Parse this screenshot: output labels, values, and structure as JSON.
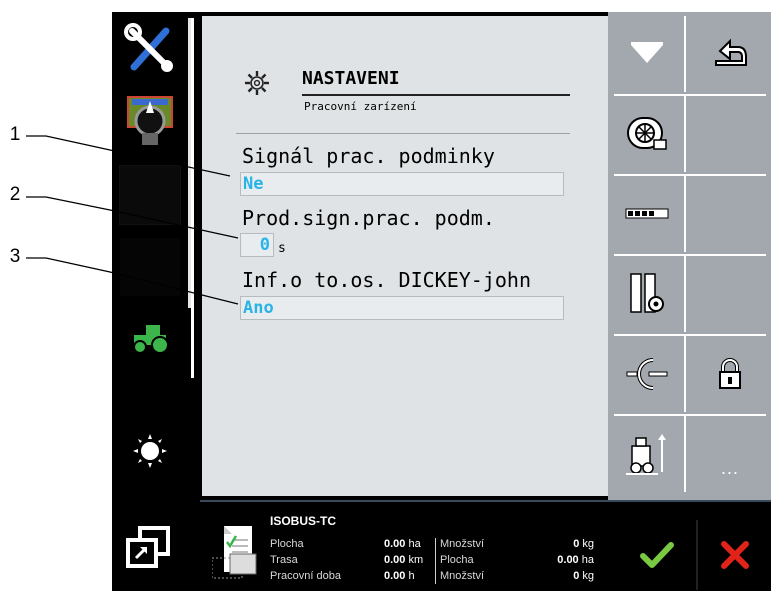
{
  "callouts": [
    "1",
    "2",
    "3"
  ],
  "header": {
    "title": "NASTAVENI",
    "subtitle": "Pracovní zarízení",
    "icon": "gear-icon"
  },
  "params": [
    {
      "label": "Signál prac. podminky",
      "value": "Ne"
    },
    {
      "label": "Prod.sign.prac. podm.",
      "value": "0",
      "unit": "s"
    },
    {
      "label": "Inf.o to.os. DICKEY-john",
      "value": "Ano"
    }
  ],
  "left_icons": [
    "tools-icon",
    "steering-icon",
    "blank-key",
    "blank-key",
    "tractor-icon",
    "brightness-icon",
    "window-switch-icon"
  ],
  "softkeys": [
    "hopper-icon",
    "back-icon",
    "fan-icon",
    "blank",
    "section-bar-icon",
    "blank",
    "tire-settings-icon",
    "blank",
    "hitch-icon",
    "lock-icon",
    "planter-lift-icon",
    "more"
  ],
  "softkey_more_label": "...",
  "task_controller": {
    "title": "ISOBUS-TC",
    "rows_left": [
      {
        "label": "Plocha",
        "value": "0.00",
        "unit": "ha"
      },
      {
        "label": "Trasa",
        "value": "0.00",
        "unit": "km"
      },
      {
        "label": "Pracovní doba",
        "value": "0.00",
        "unit": "h"
      }
    ],
    "rows_right": [
      {
        "label": "Množství",
        "value": "0",
        "unit": "kg"
      },
      {
        "label": "Plocha",
        "value": "0.00",
        "unit": "ha"
      },
      {
        "label": "Množství",
        "value": "0",
        "unit": "kg"
      }
    ]
  },
  "colors": {
    "panel": "#dfe3e5",
    "value_text": "#29b4e6",
    "softkey_bg": "#a2a8ad",
    "confirm": "#7ac943",
    "cancel": "#e2231a"
  }
}
